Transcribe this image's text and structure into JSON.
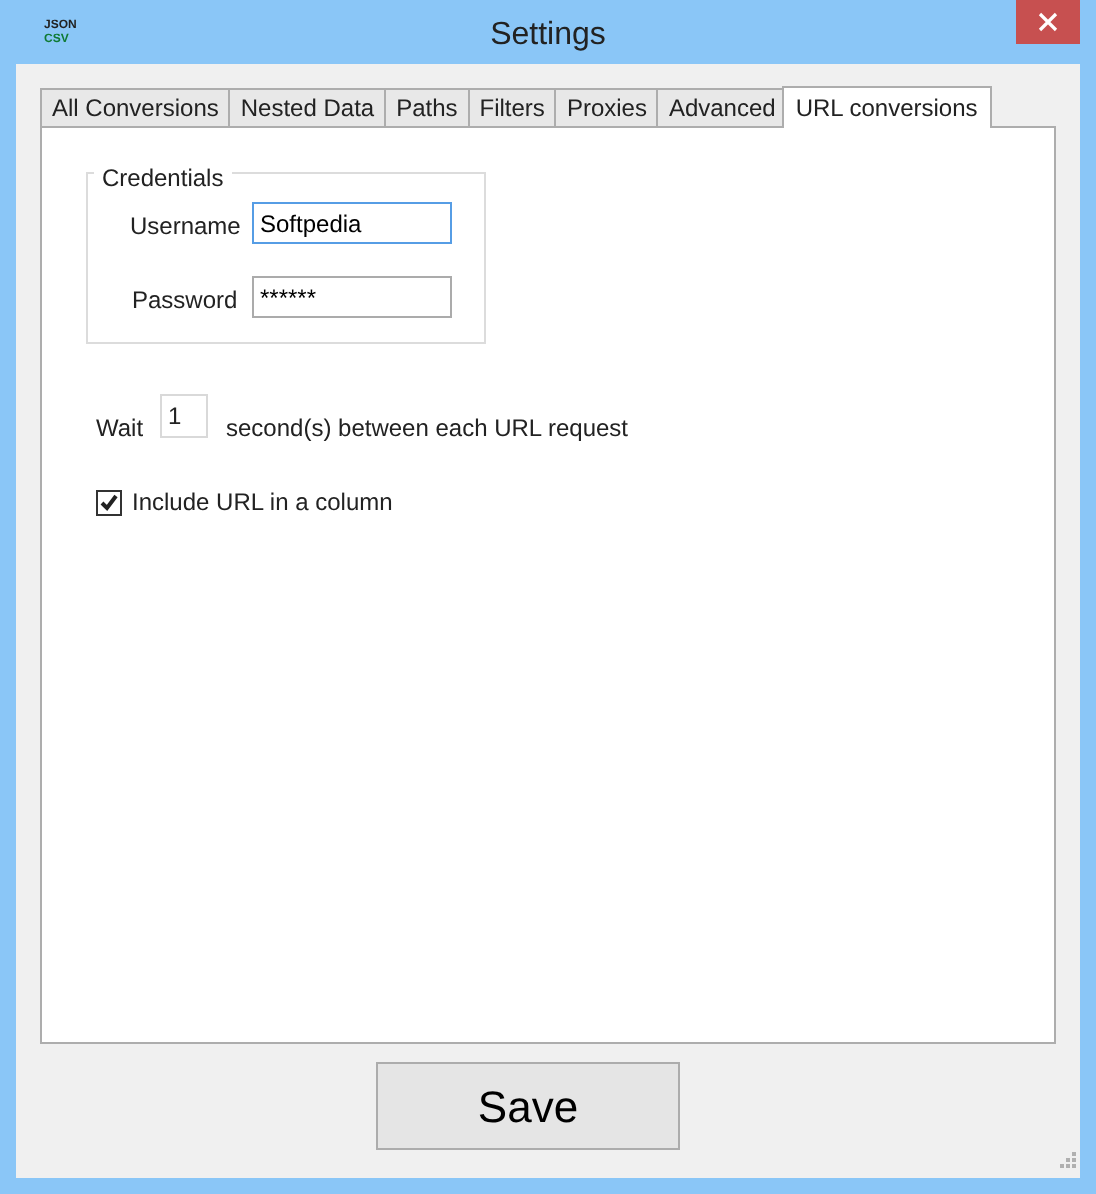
{
  "window": {
    "title": "Settings",
    "logo": [
      "JSON",
      "CSV"
    ]
  },
  "tabs": [
    {
      "label": "All Conversions",
      "selected": false
    },
    {
      "label": "Nested Data",
      "selected": false
    },
    {
      "label": "Paths",
      "selected": false
    },
    {
      "label": "Filters",
      "selected": false
    },
    {
      "label": "Proxies",
      "selected": false
    },
    {
      "label": "Advanced",
      "selected": false
    },
    {
      "label": "URL conversions",
      "selected": true
    }
  ],
  "credentials": {
    "title": "Credentials",
    "fields": [
      {
        "label": "Username",
        "value": "Softpedia",
        "focused": true
      },
      {
        "label": "Password",
        "value": "******",
        "focused": false
      }
    ]
  },
  "wait": {
    "before": "Wait",
    "value": "1",
    "after": "second(s) between each URL request"
  },
  "include_url": {
    "label": "Include URL in a column",
    "checked": true
  },
  "save_button": "Save"
}
